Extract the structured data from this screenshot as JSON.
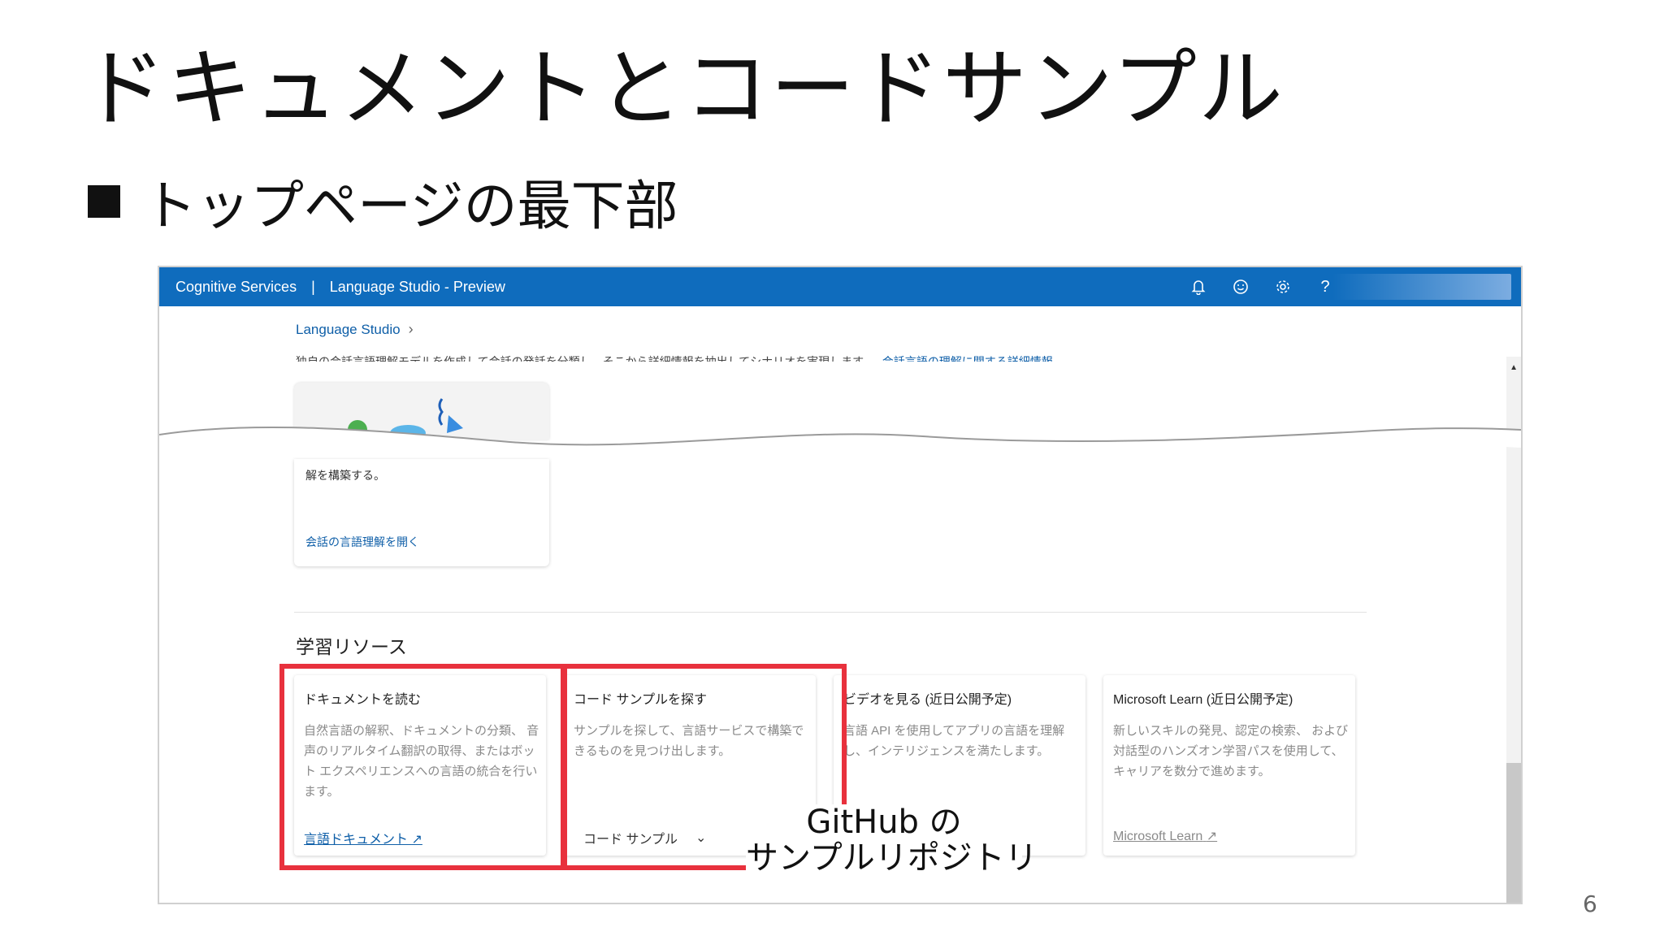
{
  "slide": {
    "title": "ドキュメントとコードサンプル",
    "bullet": "トップページの最下部",
    "page_number": "6",
    "callout": {
      "line1": "GitHub の",
      "line2": "サンプルリポジトリ"
    }
  },
  "app": {
    "brand": "Cognitive Services",
    "separator": "|",
    "product": "Language Studio - Preview",
    "header_icons": [
      "bell-icon",
      "smiley-icon",
      "gear-icon",
      "help-icon"
    ],
    "help_glyph": "?",
    "accent_color": "#0f6cbd"
  },
  "breadcrumb": {
    "label": "Language Studio",
    "chevron": "›"
  },
  "cut_description": {
    "text": "独自の会話言語理解モデルを作成して会話の発話を分類し、そこから詳細情報を抽出してシナリオを実現します。",
    "link": "会話言語の理解に関する詳細情報"
  },
  "partial_card": {
    "description": "解を構築する。",
    "link": "会話の言語理解を開く"
  },
  "learning_resources": {
    "title": "学習リソース",
    "cards": [
      {
        "title": "ドキュメントを読む",
        "description": "自然言語の解釈、ドキュメントの分類、 音声のリアルタイム翻訳の取得、またはボット エクスペリエンスへの言語の統合を行います。",
        "link": "言語ドキュメント"
      },
      {
        "title": "コード サンプルを探す",
        "description": "サンプルを探して、言語サービスで構築できるものを見つけ出します。",
        "dropdown": "コード サンプル"
      },
      {
        "title": "ビデオを見る (近日公開予定)",
        "description": "言語 API を使用してアプリの言語を理解し、インテリジェンスを満たします。"
      },
      {
        "title": "Microsoft Learn (近日公開予定)",
        "description": "新しいスキルの発見、認定の検索、 および対話型のハンズオン学習パスを使用して、キャリアを数分で進めます。",
        "link": "Microsoft Learn"
      }
    ]
  },
  "highlight_color": "#e8313d"
}
